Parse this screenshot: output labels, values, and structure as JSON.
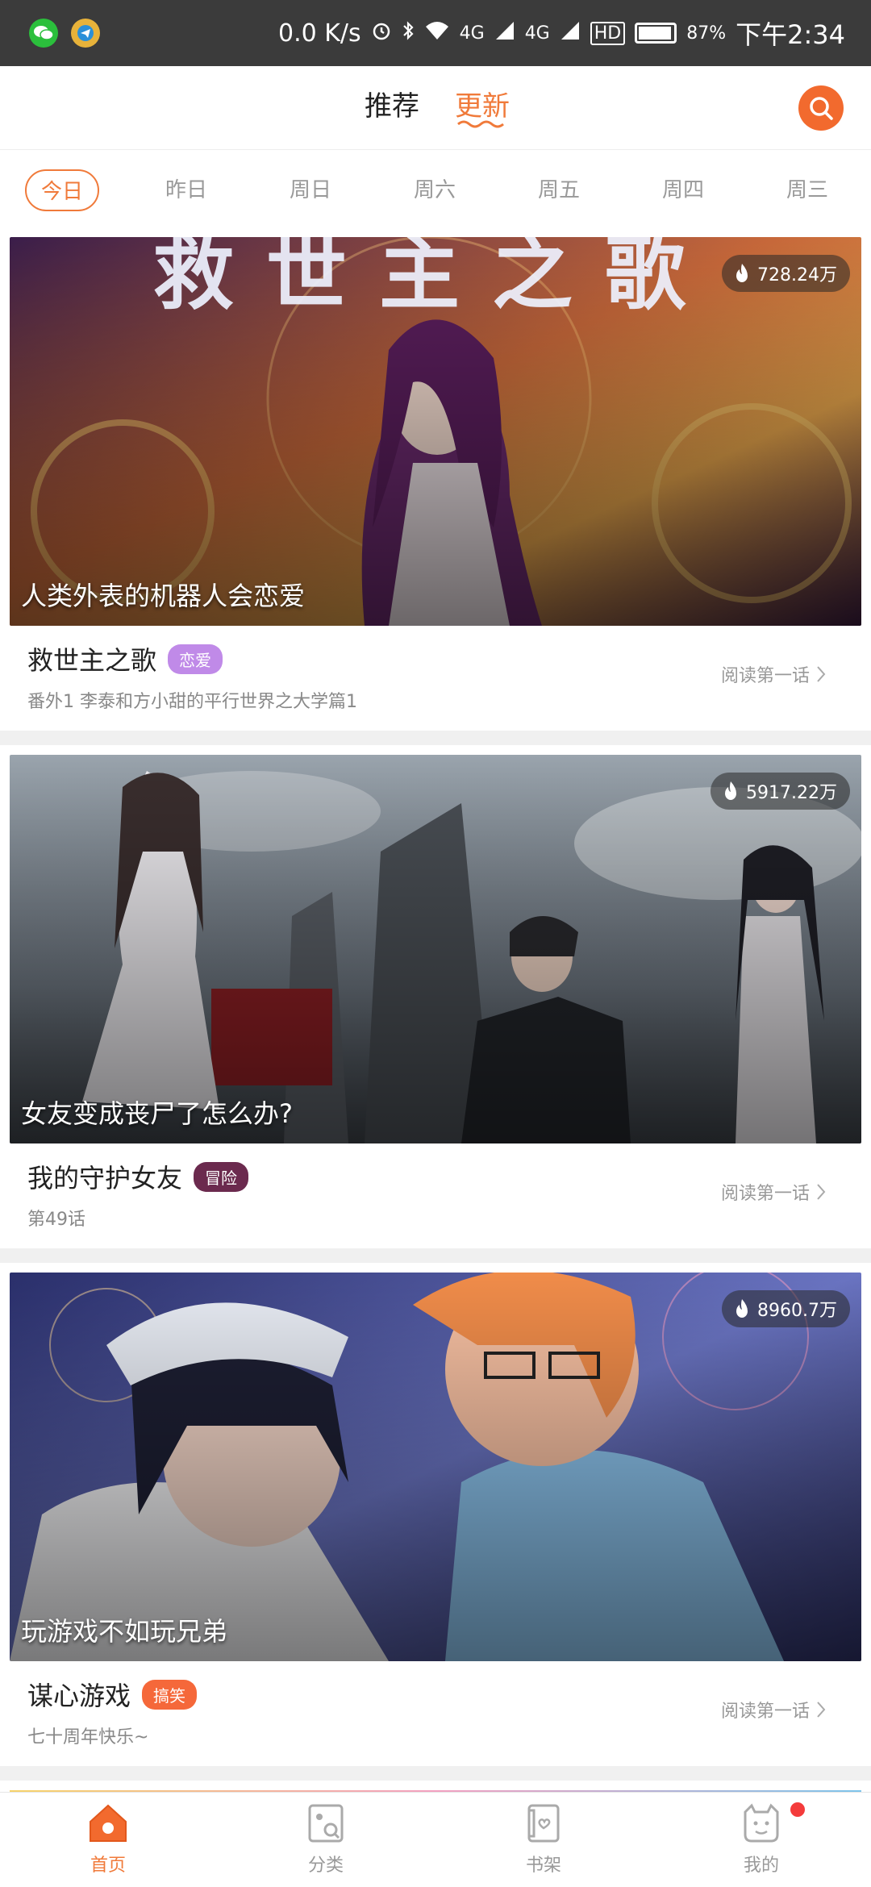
{
  "status_bar": {
    "speed": "0.0 K/s",
    "net1": "4G",
    "net2": "4G",
    "hd": "HD",
    "battery": "87%",
    "time": "下午2:34"
  },
  "top_nav": {
    "tab_recommend": "推荐",
    "tab_update": "更新",
    "active_tab": "更新",
    "accent_color": "#f07a3a"
  },
  "days": [
    "今日",
    "昨日",
    "周日",
    "周六",
    "周五",
    "周四",
    "周三"
  ],
  "active_day": "今日",
  "cards": [
    {
      "hot": "728.24万",
      "caption": "人类外表的机器人会恋爱",
      "cover_title_art": "救世主之歌",
      "title": "救世主之歌",
      "tag": "恋爱",
      "tag_color": "#c08ae8",
      "subtitle": "番外1 李泰和方小甜的平行世界之大学篇1",
      "read": "阅读第一话"
    },
    {
      "hot": "5917.22万",
      "caption": "女友变成丧尸了怎么办?",
      "title": "我的守护女友",
      "tag": "冒险",
      "tag_color": "#6b2a4e",
      "subtitle": "第49话",
      "read": "阅读第一话"
    },
    {
      "hot": "8960.7万",
      "caption": "玩游戏不如玩兄弟",
      "title": "谋心游戏",
      "tag": "搞笑",
      "tag_color": "#f5683a",
      "subtitle": "七十周年快乐~",
      "read": "阅读第一话"
    }
  ],
  "bottom_nav": {
    "home": "首页",
    "category": "分类",
    "bookshelf": "书架",
    "mine": "我的"
  }
}
